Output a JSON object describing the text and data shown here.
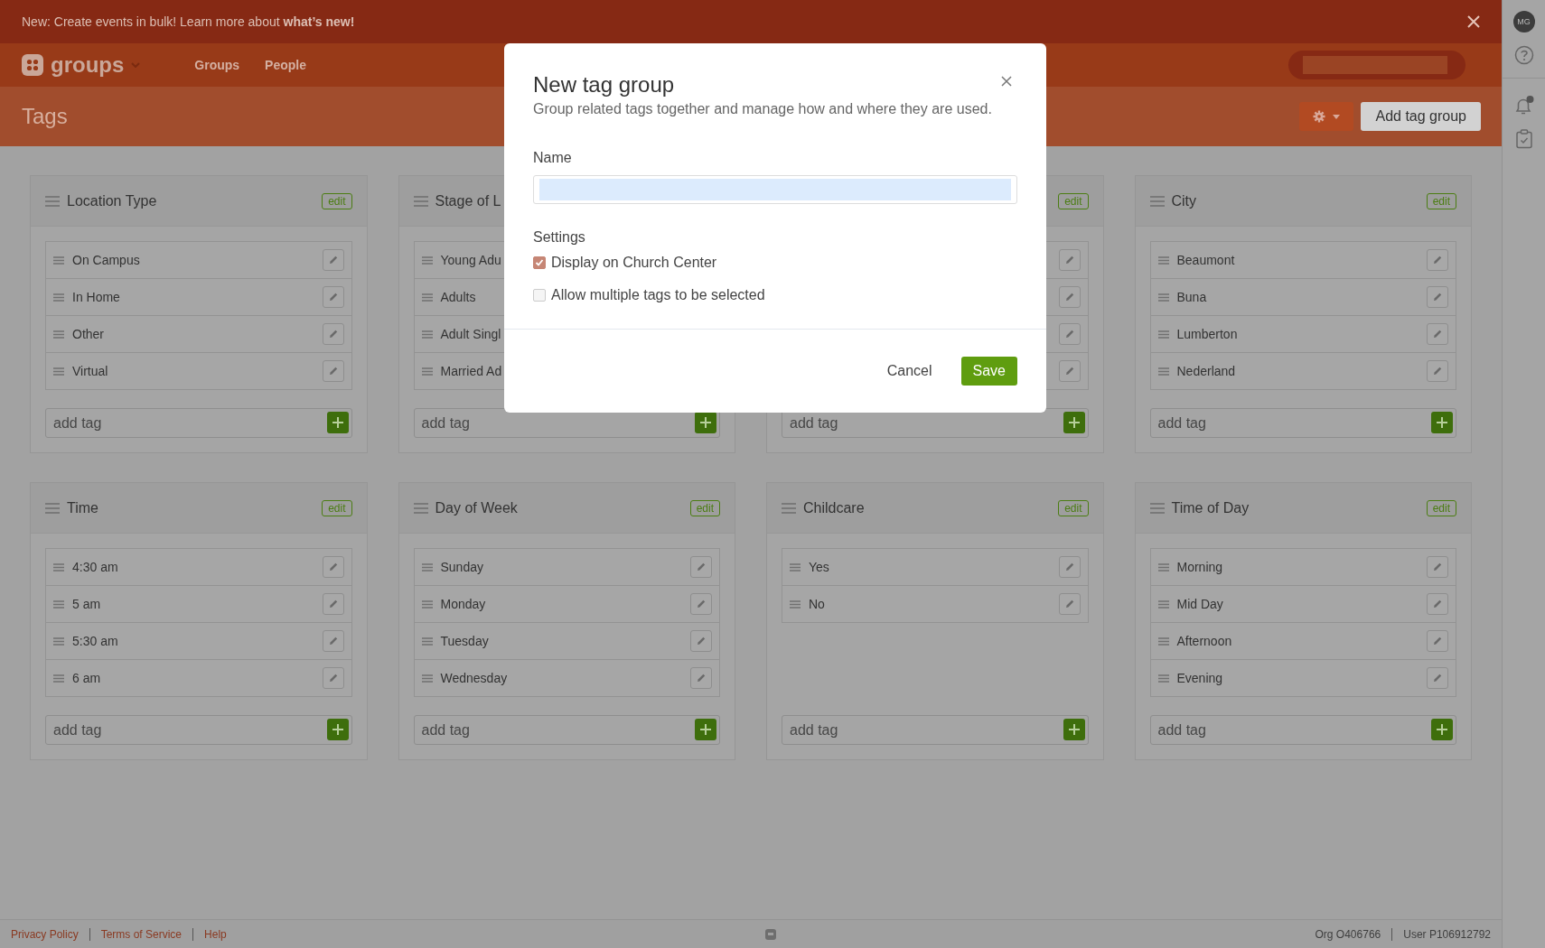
{
  "banner": {
    "text": "New: Create events in bulk! Learn more about **what’s new!**"
  },
  "nav": {
    "app_name": "groups",
    "links": [
      {
        "label": "Groups"
      },
      {
        "label": "People"
      }
    ]
  },
  "page": {
    "title": "Tags",
    "primary_button": "Add tag group"
  },
  "tag_groups": [
    {
      "title": "Location Type",
      "edit_label": "edit",
      "tags": [
        {
          "name": "On Campus"
        },
        {
          "name": "In Home"
        },
        {
          "name": "Other"
        },
        {
          "name": "Virtual"
        }
      ],
      "add_placeholder": "add tag"
    },
    {
      "title": "Stage of L",
      "tags": [
        {
          "name": "Young Adu"
        },
        {
          "name": "Adults"
        },
        {
          "name": "Adult Singl"
        },
        {
          "name": "Married Ad"
        }
      ],
      "add_placeholder": "add tag"
    },
    {
      "edit_label": "edit",
      "tags": [
        {
          "kind": "covered"
        },
        {
          "kind": "covered"
        },
        {
          "kind": "covered"
        },
        {
          "kind": "covered"
        }
      ],
      "add_placeholder": "add tag"
    },
    {
      "title": "City",
      "edit_label": "edit",
      "tags": [
        {
          "name": "Beaumont"
        },
        {
          "name": "Buna"
        },
        {
          "name": "Lumberton"
        },
        {
          "name": "Nederland"
        }
      ],
      "add_placeholder": "add tag"
    },
    {
      "title": "Time",
      "edit_label": "edit",
      "tags": [
        {
          "name": "4:30 am"
        },
        {
          "name": "5 am"
        },
        {
          "name": "5:30 am"
        },
        {
          "name": "6 am"
        }
      ],
      "add_placeholder": "add tag"
    },
    {
      "title": "Day of Week",
      "edit_label": "edit",
      "tags": [
        {
          "name": "Sunday"
        },
        {
          "name": "Monday"
        },
        {
          "name": "Tuesday"
        },
        {
          "name": "Wednesday"
        }
      ],
      "add_placeholder": "add tag"
    },
    {
      "title": "Childcare",
      "edit_label": "edit",
      "tags": [
        {
          "name": "Yes"
        },
        {
          "name": "No"
        }
      ],
      "add_placeholder": "add tag"
    },
    {
      "title": "Time of Day",
      "edit_label": "edit",
      "tags": [
        {
          "name": "Morning"
        },
        {
          "name": "Mid Day"
        },
        {
          "name": "Afternoon"
        },
        {
          "name": "Evening"
        }
      ],
      "add_placeholder": "add tag"
    }
  ],
  "modal": {
    "title": "New tag group",
    "subtitle": "Group related tags together and manage how and where they are used.",
    "name_label": "Name",
    "settings_label": "Settings",
    "settings": [
      {
        "label": "Display on Church Center",
        "checked": true
      },
      {
        "label": "Allow multiple tags to be selected",
        "checked": false
      }
    ],
    "cancel": "Cancel",
    "save": "Save"
  },
  "sidebar": {
    "avatar": "MG",
    "notification_dot": true
  },
  "footer": {
    "links": [
      {
        "label": "Privacy Policy"
      },
      {
        "label": "Terms of Service"
      },
      {
        "label": "Help"
      }
    ],
    "org": "Org O406766",
    "user": "User P106912792"
  }
}
